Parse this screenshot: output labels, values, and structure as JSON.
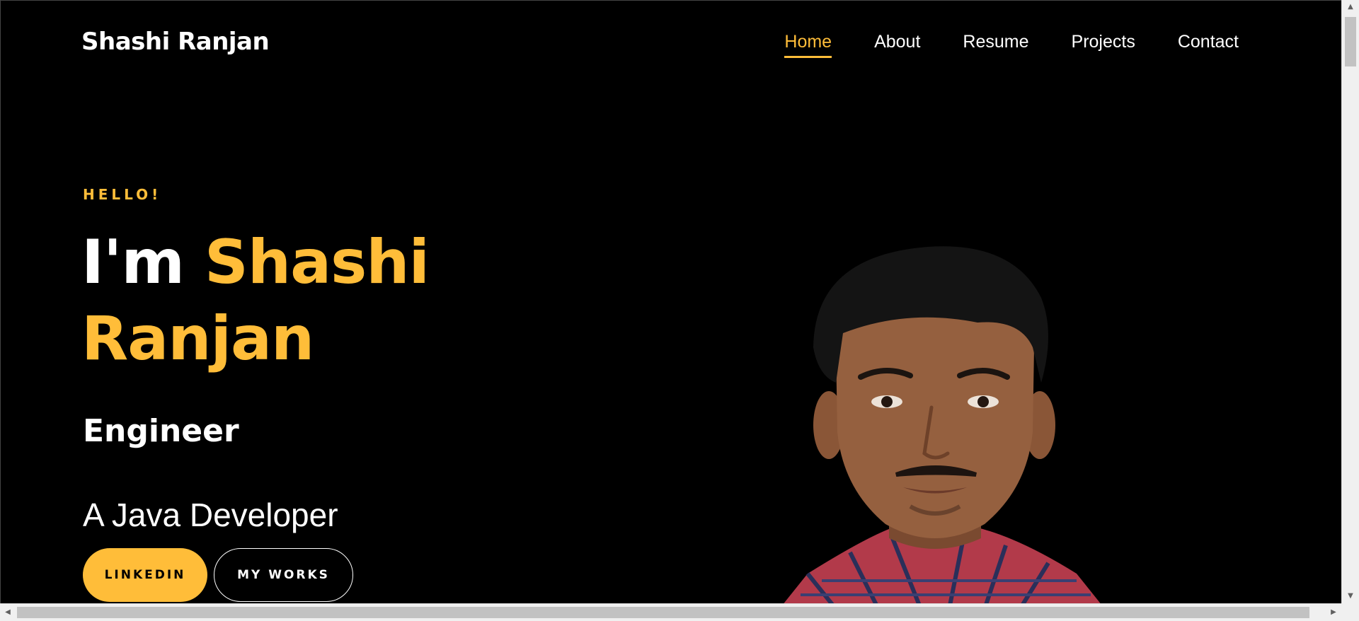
{
  "header": {
    "brand": "Shashi Ranjan",
    "nav": [
      {
        "label": "Home",
        "active": true
      },
      {
        "label": "About",
        "active": false
      },
      {
        "label": "Resume",
        "active": false
      },
      {
        "label": "Projects",
        "active": false
      },
      {
        "label": "Contact",
        "active": false
      }
    ]
  },
  "hero": {
    "greeting": "HELLO!",
    "intro": "I'm",
    "name": "Shashi Ranjan",
    "role": "Engineer",
    "subtitle": "A Java Developer",
    "buttons": {
      "primary": "LINKEDIN",
      "secondary": "MY WORKS"
    },
    "portrait_icon": "profile-photo"
  },
  "colors": {
    "background": "#000000",
    "accent": "#ffbd39",
    "text": "#ffffff"
  }
}
